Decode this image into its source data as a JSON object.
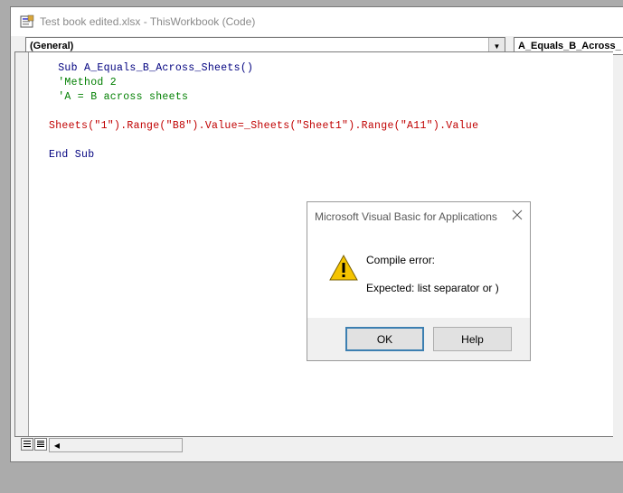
{
  "window": {
    "title": "Test book edited.xlsx - ThisWorkbook (Code)",
    "object_combo": "(General)",
    "procedure_combo": "A_Equals_B_Across_"
  },
  "code": {
    "line1": " Sub A_Equals_B_Across_Sheets()",
    "line2": " 'Method 2",
    "line3": " 'A = B across sheets",
    "line4": "Sheets(\"1\").Range(\"B8\").Value=_Sheets(\"Sheet1\").Range(\"A11\").Value",
    "line5": "End Sub"
  },
  "dialog": {
    "title": "Microsoft Visual Basic for Applications",
    "message_title": "Compile error:",
    "message_detail": "Expected: list separator or )",
    "ok_label": "OK",
    "help_label": "Help"
  },
  "colors": {
    "keyword": "#00007f",
    "comment": "#007f00",
    "error": "#c00000",
    "default_button_border": "#3c7fb1"
  },
  "icons": [
    "vba-module-icon",
    "dropdown-arrow-icon",
    "close-icon",
    "warning-icon",
    "procedure-view-icon",
    "full-module-view-icon",
    "scroll-left-arrow-icon"
  ]
}
